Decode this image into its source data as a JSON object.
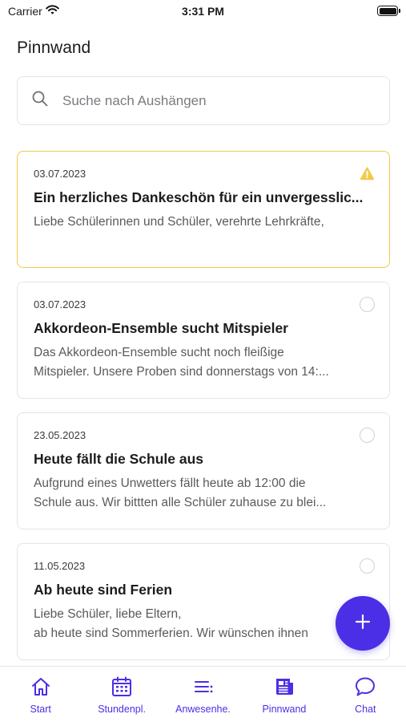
{
  "status_bar": {
    "carrier": "Carrier",
    "time": "3:31 PM"
  },
  "page_title": "Pinnwand",
  "search": {
    "placeholder": "Suche nach Aushängen",
    "value": ""
  },
  "colors": {
    "accent": "#4a2fe6",
    "warning": "#f2c94c",
    "border": "#e5e5ea"
  },
  "posts": [
    {
      "date": "03.07.2023",
      "title": "Ein herzliches Dankeschön für ein unvergesslic...",
      "body_lines": [
        "Liebe Schülerinnen und Schüler, verehrte Lehrkräfte,"
      ],
      "status_icon": "warning-icon"
    },
    {
      "date": "03.07.2023",
      "title": "Akkordeon-Ensemble sucht Mitspieler",
      "body_lines": [
        "Das Akkordeon-Ensemble sucht noch fleißige",
        "Mitspieler. Unsere Proben sind donnerstags von 14:..."
      ],
      "status_icon": "radio-circle-icon"
    },
    {
      "date": "23.05.2023",
      "title": "Heute fällt die Schule aus",
      "body_lines": [
        "Aufgrund eines Unwetters fällt heute ab 12:00 die",
        "Schule aus. Wir bittten alle Schüler zuhause zu blei..."
      ],
      "status_icon": "radio-circle-icon"
    },
    {
      "date": "11.05.2023",
      "title": "Ab heute sind Ferien",
      "body_lines": [
        "Liebe Schüler, liebe Eltern,",
        "ab heute sind Sommerferien. Wir wünschen ihnen"
      ],
      "status_icon": "radio-circle-icon"
    }
  ],
  "fab": {
    "icon": "plus-icon"
  },
  "tab_bar": {
    "tabs": [
      {
        "label": "Start",
        "icon": "home-icon"
      },
      {
        "label": "Stundenpl.",
        "icon": "calendar-icon"
      },
      {
        "label": "Anwesenhe.",
        "icon": "list-icon"
      },
      {
        "label": "Pinnwand",
        "icon": "newspaper-icon",
        "active": true
      },
      {
        "label": "Chat",
        "icon": "chat-bubble-icon"
      }
    ]
  }
}
